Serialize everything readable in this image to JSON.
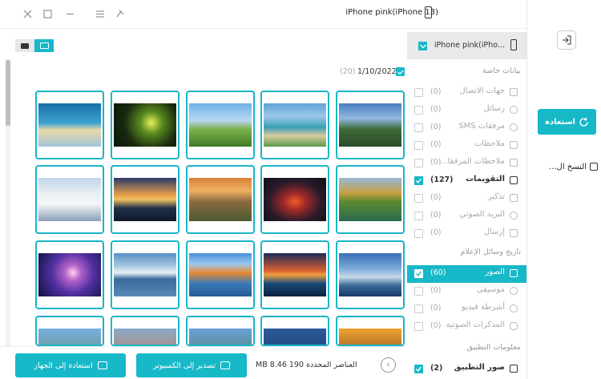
{
  "window": {
    "title": "(iPhone pink(iPhone 13",
    "controls": [
      "close-icon",
      "maximize-icon",
      "minimize-icon",
      "menu-icon",
      "pin-icon"
    ]
  },
  "device": {
    "name": "iPhone pink(iPho..."
  },
  "right_nav": {
    "back_icon": "login-icon",
    "restore_label": "استعادة",
    "backup_label": "النسخ ال..."
  },
  "sections": {
    "special": "بيانات خاصة",
    "media": "تاريخ وسائل الإعلام",
    "app": "معلومات التطبيق"
  },
  "categories": {
    "contacts": {
      "label": "جهات الاتصال",
      "count": "(0)"
    },
    "messages": {
      "label": "رسائل",
      "count": "(0)"
    },
    "sms": {
      "label": "مرفقات SMS",
      "count": "(0)"
    },
    "notes": {
      "label": "ملاحظات",
      "count": "(0)"
    },
    "note_att": {
      "label": "ملاحظات المرفقا...",
      "count": "(0)"
    },
    "calendar": {
      "label": "التقويمات",
      "count": "(127)"
    },
    "reminders": {
      "label": "تذكير",
      "count": "(0)"
    },
    "voicemail": {
      "label": "البريد الصوتي",
      "count": "(0)"
    },
    "bookmarks": {
      "label": "إرسال",
      "count": "(0)"
    },
    "photos": {
      "label": "الصور",
      "count": "(60)"
    },
    "music": {
      "label": "موسيقى",
      "count": "(0)"
    },
    "videos": {
      "label": "أشرطة فيديو",
      "count": "(0)"
    },
    "voicememos": {
      "label": "المذكرات الصوتية",
      "count": "(0)"
    },
    "appphotos": {
      "label": "صور التطبيق",
      "count": "(2)"
    }
  },
  "gallery": {
    "date": "1/10/2022",
    "date_count": "(20)"
  },
  "bottom": {
    "restore_device": "استعادة إلى الجهاز",
    "export_pc": "تصدير إلى الكمبيوتر",
    "selection_info": "العناصر المحددة 190 MB 8.46"
  },
  "colors": {
    "accent": "#17b8c8"
  }
}
